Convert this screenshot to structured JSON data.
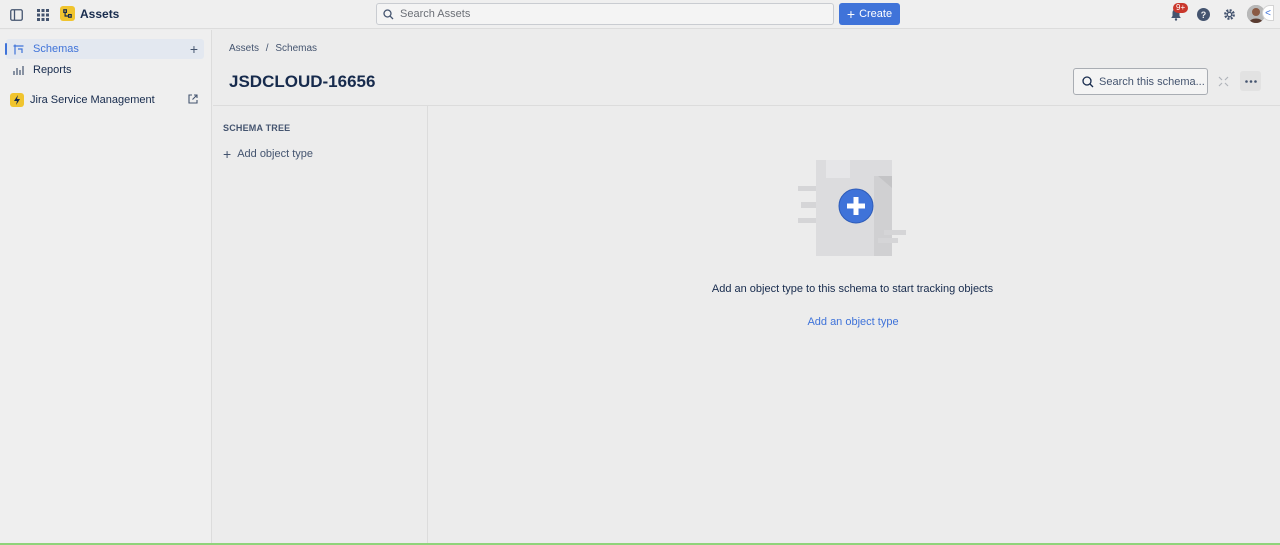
{
  "topbar": {
    "app_name": "Assets",
    "search_placeholder": "Search Assets",
    "create_label": "Create",
    "notification_count": "9+",
    "icons": [
      "sidebar-toggle-icon",
      "app-switcher-icon",
      "assets-logo-icon",
      "search-icon",
      "notification-icon",
      "help-icon",
      "settings-icon"
    ]
  },
  "sidebar": {
    "items": [
      {
        "label": "Schemas",
        "icon": "schema-icon",
        "selected": true
      },
      {
        "label": "Reports",
        "icon": "chart-icon",
        "selected": false
      },
      {
        "label": "Jira Service Management",
        "icon": "jsm-logo-icon",
        "selected": false
      }
    ]
  },
  "breadcrumb": {
    "items": [
      "Assets",
      "Schemas"
    ],
    "separator": "/"
  },
  "page": {
    "title": "JSDCLOUD-16656",
    "schema_search_placeholder": "Search this schema..."
  },
  "schema_tree": {
    "heading": "SCHEMA TREE",
    "add_label": "Add object type"
  },
  "empty_state": {
    "message": "Add an object type to this schema to start tracking objects",
    "link_label": "Add an object type"
  },
  "colors": {
    "accent": "#3f73d9",
    "badge": "#c9372c",
    "brand_yellow": "#f0c42e"
  }
}
